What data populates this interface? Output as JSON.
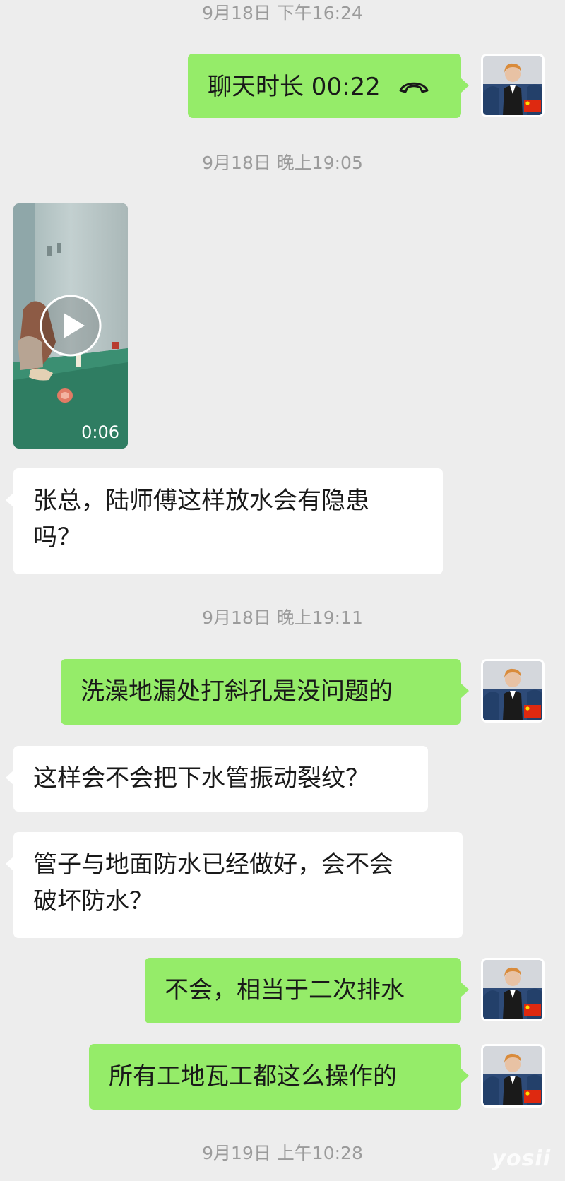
{
  "timestamps": {
    "t1": "9月18日 下午16:24",
    "t2": "9月18日 晚上19:05",
    "t3": "9月18日 晚上19:11",
    "t4": "9月19日 上午10:28"
  },
  "messages": {
    "call": "聊天时长 00:22",
    "video_duration": "0:06",
    "q1_line1": "张总，陆师傅这样放水会有隐患",
    "q1_line2": "吗？",
    "a1": "洗澡地漏处打斜孔是没问题的",
    "q2": "这样会不会把下水管振动裂纹？",
    "q3_line1": "管子与地面防水已经做好，会不会",
    "q3_line2": "破坏防水？",
    "a2": "不会，相当于二次排水",
    "a3": "所有工地瓦工都这么操作的"
  },
  "icons": {
    "call": "phone-hangup-icon",
    "play": "play-icon",
    "flag": "china-flag-icon"
  },
  "colors": {
    "background": "#ededed",
    "my_bubble": "#95ec69",
    "other_bubble": "#ffffff",
    "timestamp": "#9b9b9b"
  },
  "watermark": "yosii"
}
